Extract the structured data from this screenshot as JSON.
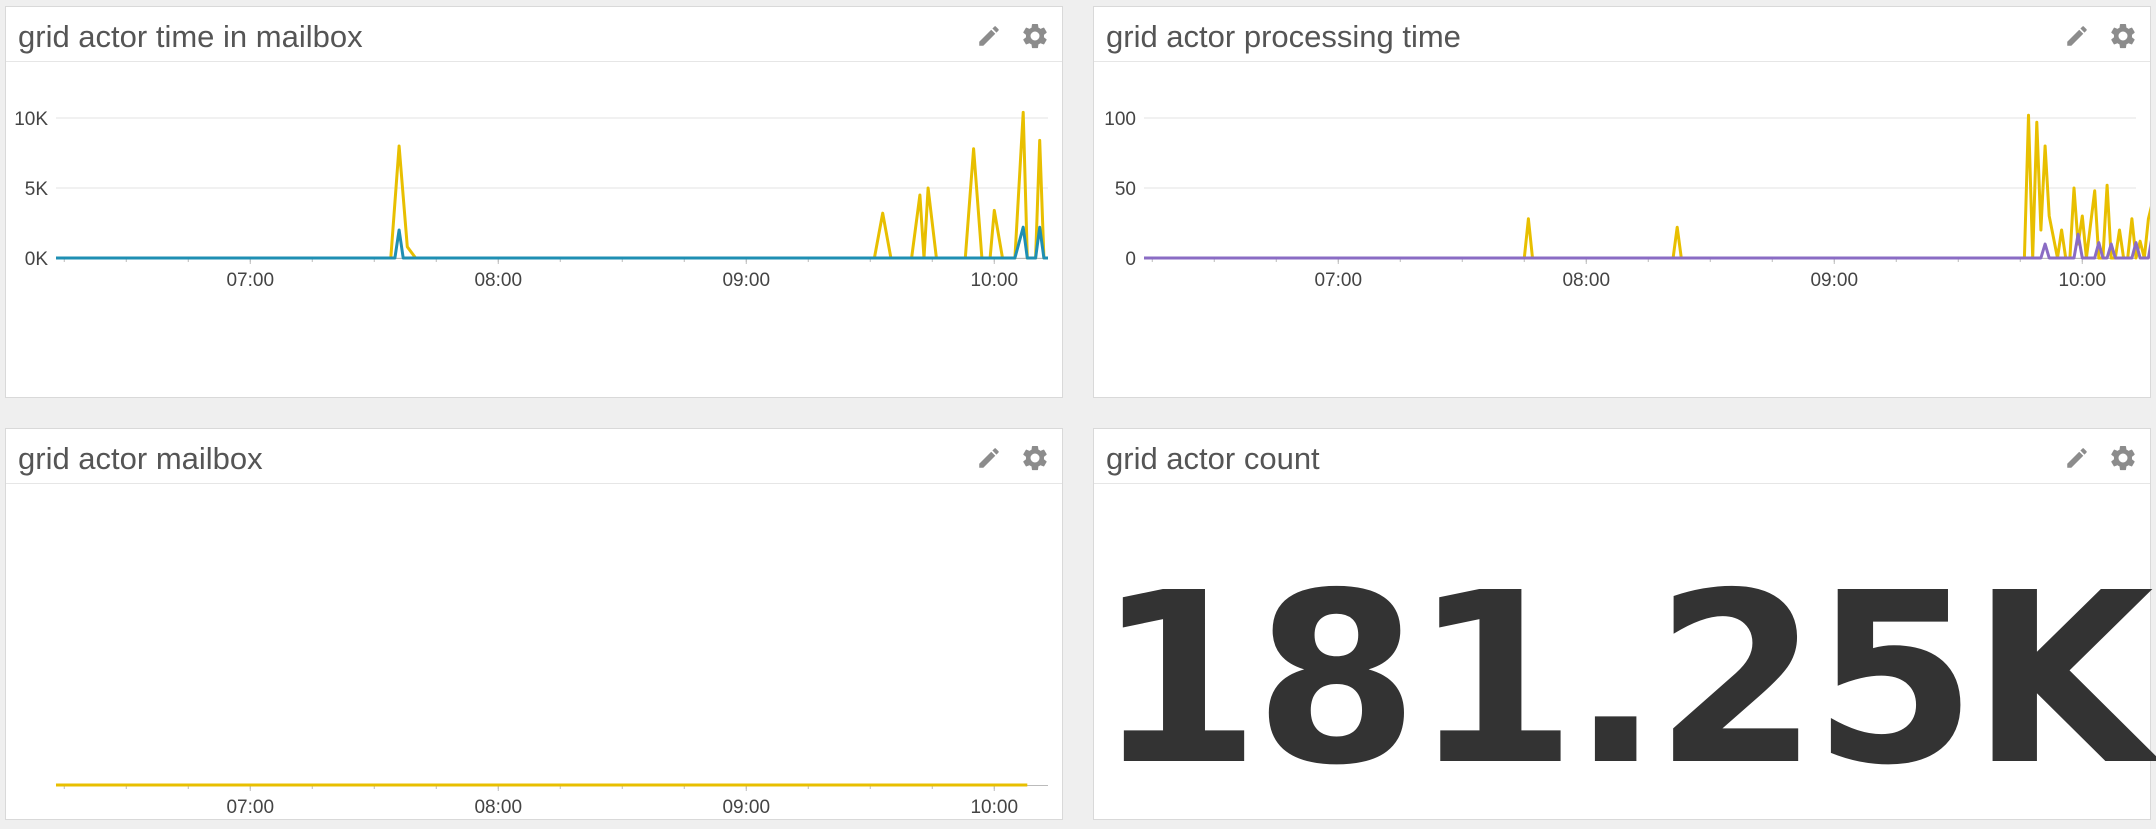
{
  "colors": {
    "yellow": "#e8bf00",
    "teal": "#1f8fb3",
    "purple": "#8a6cc4",
    "grid": "#e3e3e3",
    "axis": "#bbbbbb",
    "icon": "#8c8c8c"
  },
  "icons": {
    "edit": "pencil-icon",
    "settings": "gear-icon"
  },
  "panels": {
    "time_in_mailbox": {
      "title": "grid actor time in mailbox"
    },
    "processing_time": {
      "title": "grid actor processing time"
    },
    "mailbox": {
      "title": "grid actor mailbox"
    },
    "actor_count": {
      "title": "grid actor count",
      "value": "181.25K"
    }
  },
  "chart_data": [
    {
      "id": "time_in_mailbox",
      "type": "line",
      "title": "grid actor time in mailbox",
      "x_ticks": [
        "07:00",
        "08:00",
        "09:00",
        "10:00"
      ],
      "y_ticks": [
        "0K",
        "5K",
        "10K"
      ],
      "xlim": [
        "06:13",
        "10:13"
      ],
      "ylim": [
        0,
        12500
      ],
      "grid": true,
      "series": [
        {
          "color": "yellow",
          "points": [
            [
              "06:13",
              0
            ],
            [
              "07:34",
              0
            ],
            [
              "07:36",
              8000
            ],
            [
              "07:38",
              800
            ],
            [
              "07:40",
              0
            ],
            [
              "09:31",
              0
            ],
            [
              "09:33",
              3200
            ],
            [
              "09:35",
              0
            ],
            [
              "09:40",
              0
            ],
            [
              "09:42",
              4500
            ],
            [
              "09:43",
              0
            ],
            [
              "09:44",
              5000
            ],
            [
              "09:46",
              0
            ],
            [
              "09:53",
              0
            ],
            [
              "09:55",
              7800
            ],
            [
              "09:57",
              0
            ],
            [
              "09:59",
              0
            ],
            [
              "10:00",
              3400
            ],
            [
              "10:02",
              0
            ],
            [
              "10:05",
              0
            ],
            [
              "10:07",
              10400
            ],
            [
              "10:08",
              0
            ],
            [
              "10:10",
              0
            ],
            [
              "10:11",
              8400
            ],
            [
              "10:12",
              0
            ],
            [
              "10:13",
              0
            ]
          ]
        },
        {
          "color": "teal",
          "points": [
            [
              "06:13",
              0
            ],
            [
              "07:35",
              0
            ],
            [
              "07:36",
              2000
            ],
            [
              "07:37",
              0
            ],
            [
              "10:05",
              0
            ],
            [
              "10:07",
              2200
            ],
            [
              "10:08",
              0
            ],
            [
              "10:10",
              0
            ],
            [
              "10:11",
              2200
            ],
            [
              "10:12",
              0
            ],
            [
              "10:13",
              0
            ]
          ]
        }
      ]
    },
    {
      "id": "processing_time",
      "type": "line",
      "title": "grid actor processing time",
      "x_ticks": [
        "07:00",
        "08:00",
        "09:00",
        "10:00"
      ],
      "y_ticks": [
        "0",
        "50",
        "100"
      ],
      "xlim": [
        "06:13",
        "10:13"
      ],
      "ylim": [
        0,
        125
      ],
      "grid": true,
      "series": [
        {
          "color": "yellow",
          "points": [
            [
              "06:13",
              0
            ],
            [
              "07:45",
              0
            ],
            [
              "07:46",
              28
            ],
            [
              "07:47",
              0
            ],
            [
              "08:21",
              0
            ],
            [
              "08:22",
              22
            ],
            [
              "08:23",
              0
            ],
            [
              "09:46",
              0
            ],
            [
              "09:47",
              102
            ],
            [
              "09:48",
              0
            ],
            [
              "09:49",
              97
            ],
            [
              "09:50",
              20
            ],
            [
              "09:51",
              80
            ],
            [
              "09:52",
              30
            ],
            [
              "09:54",
              0
            ],
            [
              "09:55",
              20
            ],
            [
              "09:56",
              0
            ],
            [
              "09:57",
              0
            ],
            [
              "09:58",
              50
            ],
            [
              "09:59",
              10
            ],
            [
              "10:00",
              30
            ],
            [
              "10:01",
              0
            ],
            [
              "10:03",
              48
            ],
            [
              "10:04",
              0
            ],
            [
              "10:05",
              0
            ],
            [
              "10:06",
              52
            ],
            [
              "10:07",
              0
            ],
            [
              "10:08",
              0
            ],
            [
              "10:09",
              20
            ],
            [
              "10:10",
              0
            ],
            [
              "10:11",
              0
            ],
            [
              "10:12",
              28
            ],
            [
              "10:13",
              0
            ],
            [
              "10:14",
              12
            ],
            [
              "10:15",
              0
            ],
            [
              "10:16",
              28
            ],
            [
              "10:17",
              40
            ],
            [
              "10:18",
              24
            ],
            [
              "10:19",
              41
            ],
            [
              "10:20",
              28
            ]
          ]
        },
        {
          "color": "purple",
          "points": [
            [
              "06:13",
              0
            ],
            [
              "09:50",
              0
            ],
            [
              "09:51",
              10
            ],
            [
              "09:52",
              0
            ],
            [
              "09:58",
              0
            ],
            [
              "09:59",
              17
            ],
            [
              "10:00",
              0
            ],
            [
              "10:03",
              0
            ],
            [
              "10:04",
              11
            ],
            [
              "10:05",
              0
            ],
            [
              "10:06",
              0
            ],
            [
              "10:07",
              10
            ],
            [
              "10:08",
              0
            ],
            [
              "10:12",
              0
            ],
            [
              "10:13",
              11
            ],
            [
              "10:14",
              0
            ],
            [
              "10:16",
              0
            ],
            [
              "10:17",
              17
            ],
            [
              "10:18",
              0
            ],
            [
              "10:19",
              0
            ],
            [
              "10:20",
              17
            ]
          ]
        }
      ]
    },
    {
      "id": "mailbox",
      "type": "line",
      "title": "grid actor mailbox",
      "x_ticks": [
        "07:00",
        "08:00",
        "09:00",
        "10:00"
      ],
      "y_ticks": [],
      "xlim": [
        "06:13",
        "10:13"
      ],
      "ylim": [
        0,
        1
      ],
      "grid": false,
      "series": [
        {
          "color": "yellow",
          "points": [
            [
              "06:13",
              0
            ],
            [
              "10:08",
              0
            ]
          ]
        }
      ]
    }
  ]
}
